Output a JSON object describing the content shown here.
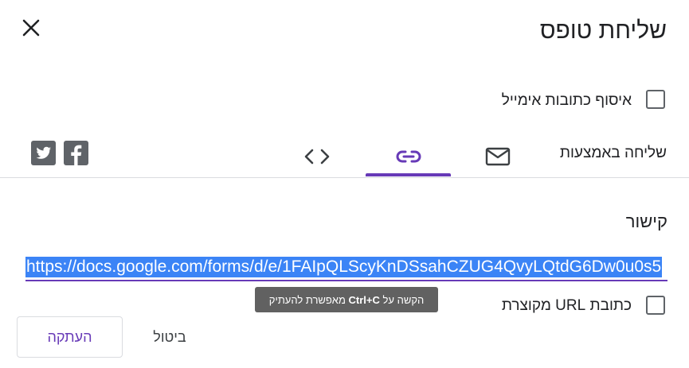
{
  "dialog": {
    "title": "שליחת טופס",
    "collect_emails_label": "איסוף כתובות אימייל",
    "send_via_label": "שליחה באמצעות",
    "tabs": [
      {
        "name": "email",
        "icon": "envelope-icon"
      },
      {
        "name": "link",
        "icon": "link-icon",
        "selected": true
      },
      {
        "name": "embed",
        "icon": "embed-code-icon"
      }
    ],
    "social": [
      {
        "name": "facebook",
        "icon": "facebook-icon"
      },
      {
        "name": "twitter",
        "icon": "twitter-icon"
      }
    ],
    "link_section_label": "קישור",
    "link_url": "https://docs.google.com/forms/d/e/1FAIpQLScyKnDSsahCZUG4QvyLQtdG6Dw0u0s5",
    "tooltip": {
      "prefix": "הקשה על",
      "shortcut": "Ctrl+C",
      "suffix": "מאפשרת להעתיק"
    },
    "shorten_url_label": "כתובת URL מקוצרת",
    "cancel_label": "ביטול",
    "copy_label": "העתקה",
    "accent_color": "#673ab7",
    "selection_color": "#3b84f6"
  }
}
